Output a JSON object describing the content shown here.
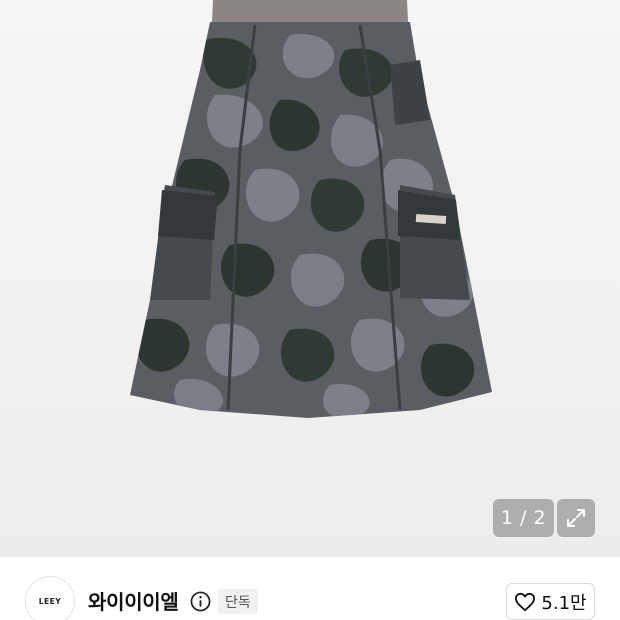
{
  "gallery": {
    "image_alt": "camouflage cargo midi skirt",
    "pager_text": "1 / 2",
    "expand_icon": "expand-arrows-icon"
  },
  "brand": {
    "logo_text": "LEEY",
    "name": "와이이이엘",
    "info_icon": "info-icon",
    "badge": "단독"
  },
  "like": {
    "icon": "heart-outline-icon",
    "count": "5.1만"
  },
  "colors": {
    "camo_dark": "#2c3833",
    "camo_mid": "#4d5458",
    "camo_light": "#7b7e86",
    "waistband": "#8b8583"
  }
}
